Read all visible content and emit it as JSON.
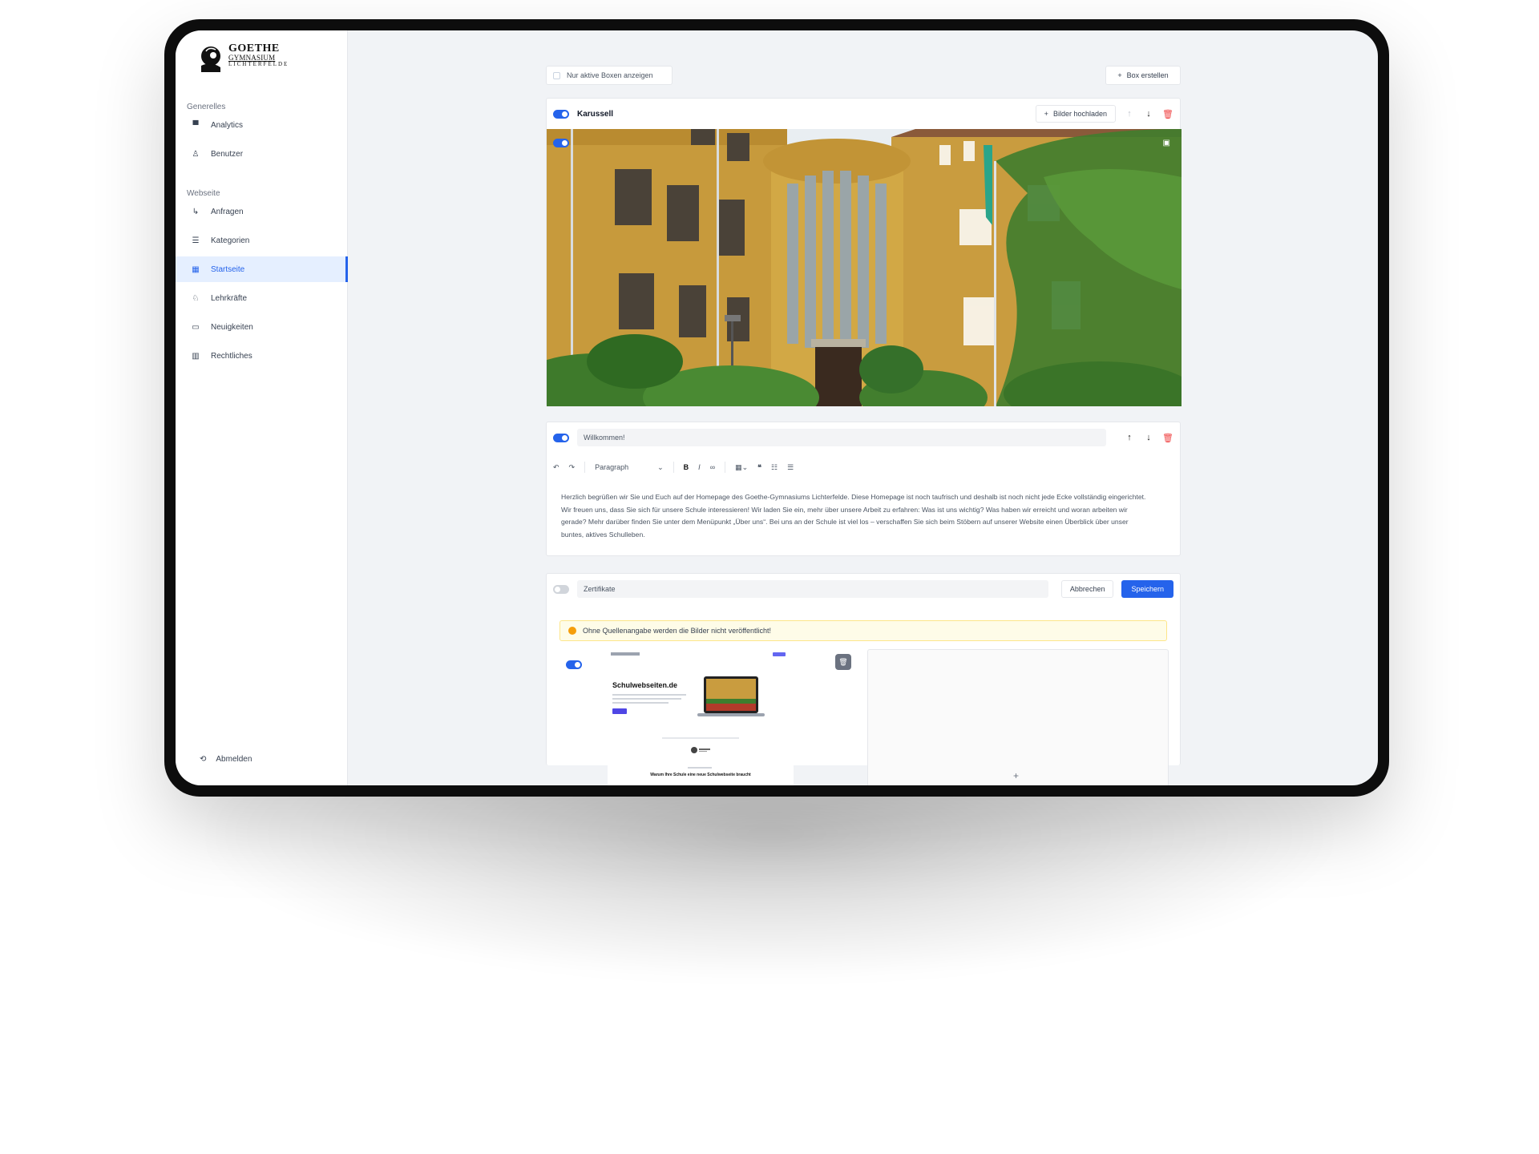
{
  "logo": {
    "line1": "GOETHE",
    "line2": "GYMNASIUM",
    "line3": "LICHTERFELDE"
  },
  "sidebar": {
    "section1": "Generelles",
    "section2": "Webseite",
    "items": [
      {
        "label": "Analytics",
        "icon": "chart-icon"
      },
      {
        "label": "Benutzer",
        "icon": "user-icon"
      },
      {
        "label": "Anfragen",
        "icon": "inquiry-icon"
      },
      {
        "label": "Kategorien",
        "icon": "list-icon"
      },
      {
        "label": "Startseite",
        "icon": "grid-icon"
      },
      {
        "label": "Lehrkräfte",
        "icon": "teacher-icon"
      },
      {
        "label": "Neuigkeiten",
        "icon": "calendar-icon"
      },
      {
        "label": "Rechtliches",
        "icon": "bank-icon"
      }
    ],
    "active": "Startseite",
    "logout": "Abmelden"
  },
  "toolbar": {
    "filter_label": "Nur aktive Boxen anzeigen",
    "create_label": "Box erstellen"
  },
  "carousel": {
    "title": "Karussell",
    "upload_label": "Bilder hochladen"
  },
  "welcome": {
    "title": "Willkommen!",
    "format": "Paragraph",
    "text": "Herzlich begrüßen wir Sie und Euch auf der Homepage des Goethe-Gymnasiums Lichterfelde. Diese Homepage ist noch taufrisch und deshalb ist noch nicht jede Ecke vollständig eingerichtet. Wir freuen uns, dass Sie sich für unsere Schule interessieren! Wir laden Sie ein, mehr über unsere Arbeit zu erfahren: Was ist uns wichtig? Was haben wir erreicht und woran arbeiten wir gerade? Mehr darüber finden Sie unter dem Menüpunkt „Über uns“. Bei uns an der Schule ist viel los – verschaffen Sie sich beim Stöbern auf unserer Website einen Überblick über unser buntes, aktives Schulleben."
  },
  "certificates": {
    "title": "Zertifikate",
    "cancel_label": "Abbrechen",
    "save_label": "Speichern",
    "warning": "Ohne Quellenangabe werden die Bilder nicht veröffentlicht!",
    "preview_title": "Schulwebseiten.de",
    "preview_heading": "Warum Ihre Schule eine neue Schulwebseite braucht"
  },
  "colors": {
    "accent": "#2563eb",
    "danger": "#ef4444",
    "warning": "#f59e0b",
    "sidebar_active_bg": "#e5efff"
  }
}
